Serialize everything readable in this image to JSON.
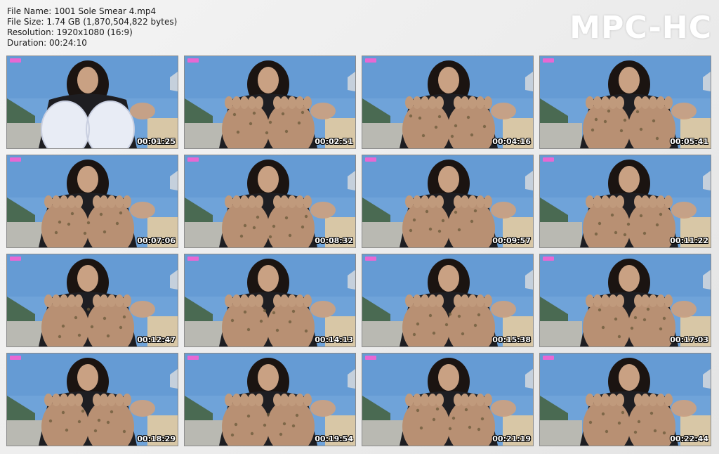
{
  "file_info": {
    "name": "File Name: 1001 Sole Smear 4.mp4",
    "size": "File Size: 1.74 GB (1,870,504,822 bytes)",
    "resolution": "Resolution: 1920x1080 (16:9)",
    "duration": "Duration: 00:24:10"
  },
  "logo_text": "MPC-HC",
  "colors": {
    "sky": "#6fa3d9",
    "jacket": "#1e1e22",
    "skin": "#c9a183",
    "sole": "#b89073",
    "sock": "#e8ecf5",
    "grass": "#4a6a52",
    "fence": "#b9b9b2",
    "watermark": "#ff5fd2"
  },
  "thumbnails": [
    {
      "time": "00:01:25",
      "feet": "socks"
    },
    {
      "time": "00:02:51",
      "feet": "bare"
    },
    {
      "time": "00:04:16",
      "feet": "bare"
    },
    {
      "time": "00:05:41",
      "feet": "bare"
    },
    {
      "time": "00:07:06",
      "feet": "bare"
    },
    {
      "time": "00:08:32",
      "feet": "bare"
    },
    {
      "time": "00:09:57",
      "feet": "bare"
    },
    {
      "time": "00:11:22",
      "feet": "bare"
    },
    {
      "time": "00:12:47",
      "feet": "bare"
    },
    {
      "time": "00:14:13",
      "feet": "bare"
    },
    {
      "time": "00:15:38",
      "feet": "bare"
    },
    {
      "time": "00:17:03",
      "feet": "bare"
    },
    {
      "time": "00:18:29",
      "feet": "bare"
    },
    {
      "time": "00:19:54",
      "feet": "bare"
    },
    {
      "time": "00:21:19",
      "feet": "bare"
    },
    {
      "time": "00:22:44",
      "feet": "bare"
    }
  ]
}
